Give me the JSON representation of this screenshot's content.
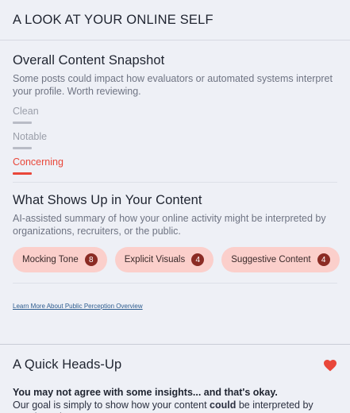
{
  "header": {
    "title": "A LOOK AT YOUR ONLINE SELF"
  },
  "snapshot": {
    "title": "Overall Content Snapshot",
    "description": "Some posts could impact how evaluators or automated systems interpret your profile. Worth reviewing.",
    "levels": [
      {
        "label": "Clean"
      },
      {
        "label": "Notable"
      },
      {
        "label": "Concerning"
      }
    ],
    "active_level": "Concerning"
  },
  "shows": {
    "title": "What Shows Up in Your Content",
    "description": "AI-assisted summary of how your online activity might be interpreted by organizations, recruiters, or the public.",
    "chips": [
      {
        "label": "Mocking Tone",
        "count": "8"
      },
      {
        "label": "Explicit Visuals",
        "count": "4"
      },
      {
        "label": "Suggestive Content",
        "count": "4"
      }
    ]
  },
  "learn_more": {
    "label": "Learn More About Public Perception Overview"
  },
  "heads_up": {
    "title": "A Quick Heads-Up",
    "icon": "heart-icon",
    "strong_line": "You may not agree with some insights... and that's okay.",
    "body_prefix": "Our goal is simply to show how your content ",
    "body_emphasis": "could",
    "body_suffix": " be interpreted by people and AI."
  },
  "colors": {
    "accent": "#e9473a",
    "chip_bg": "#fbcfcb",
    "badge_bg": "#8b2b24",
    "link": "#2d5c8f",
    "heart": "#e9473a"
  }
}
